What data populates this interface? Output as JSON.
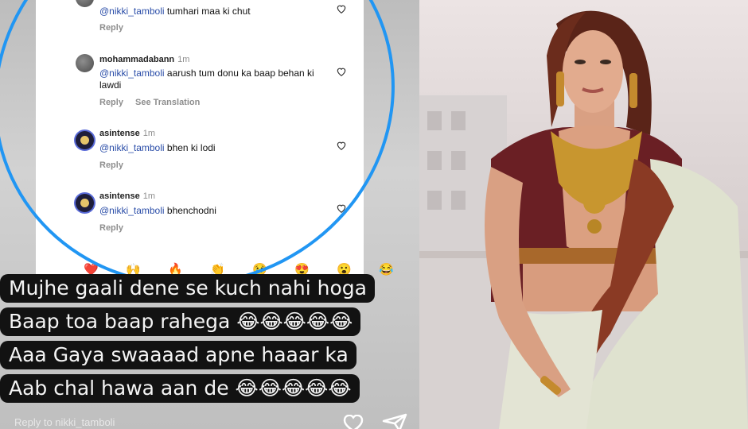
{
  "comments": [
    {
      "username": "",
      "time": "",
      "mention": "@nikki_tamboli",
      "text": "tumhari maa ki chut",
      "actions": [
        "Reply"
      ]
    },
    {
      "username": "mohammadabann",
      "time": "1m",
      "mention": "@nikki_tamboli",
      "text": "aarush tum donu ka baap behan ki lawdi",
      "actions": [
        "Reply",
        "See Translation"
      ]
    },
    {
      "username": "asintense",
      "time": "1m",
      "mention": "@nikki_tamboli",
      "text": "bhen ki lodi",
      "actions": [
        "Reply"
      ]
    },
    {
      "username": "asintense",
      "time": "1m",
      "mention": "@nikki_tamboli",
      "text": "bhenchodni",
      "actions": [
        "Reply"
      ]
    }
  ],
  "emoji_row": [
    "❤️",
    "🙌",
    "🔥",
    "👏",
    "😢",
    "😍",
    "😮",
    "😂"
  ],
  "caption": {
    "line1": "Mujhe gaali dene se kuch nahi hoga",
    "line2": "Baap toa baap rahega 😂😂😂😂😂",
    "line3": "Aaa Gaya swaaaad apne haaar ka",
    "line4": "Aab chal hawa aan de 😂😂😂😂😂"
  },
  "reply": {
    "label": "Reply to nikki_tamboli"
  },
  "colors": {
    "ring": "#2196f3",
    "mention": "#2a4da8",
    "blouse": "#6a1f24",
    "saree": "#dfe2cf"
  }
}
